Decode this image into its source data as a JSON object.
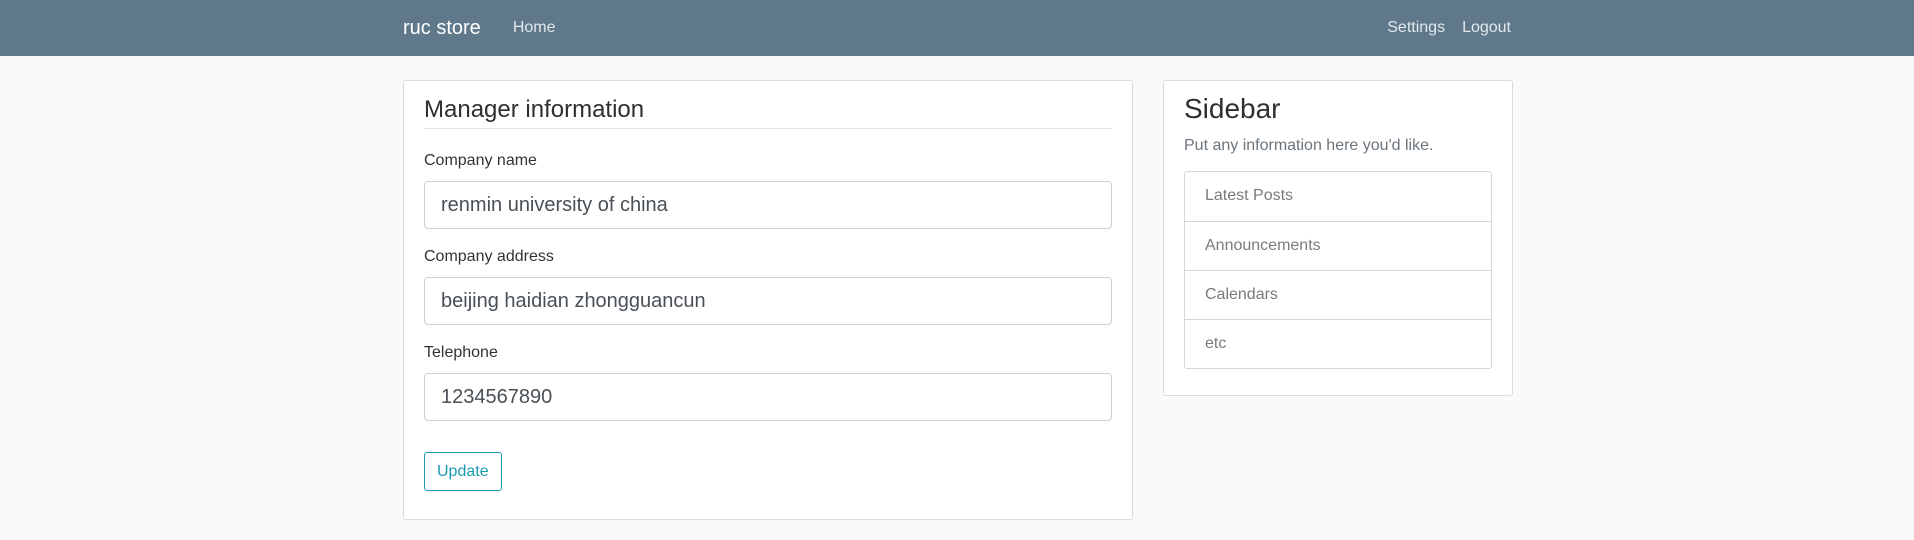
{
  "navbar": {
    "brand": "ruc store",
    "home": "Home",
    "settings": "Settings",
    "logout": "Logout",
    "background": "#5f788a"
  },
  "form": {
    "title": "Manager information",
    "fields": [
      {
        "label": "Company name",
        "value": "renmin university of china"
      },
      {
        "label": "Company address",
        "value": "beijing haidian zhongguancun"
      },
      {
        "label": "Telephone",
        "value": "1234567890"
      }
    ],
    "submit_label": "Update",
    "accent": "#1a9bb0"
  },
  "sidebar": {
    "title": "Sidebar",
    "description": "Put any information here you'd like.",
    "items": [
      {
        "label": "Latest Posts"
      },
      {
        "label": "Announcements"
      },
      {
        "label": "Calendars"
      },
      {
        "label": "etc"
      }
    ]
  }
}
